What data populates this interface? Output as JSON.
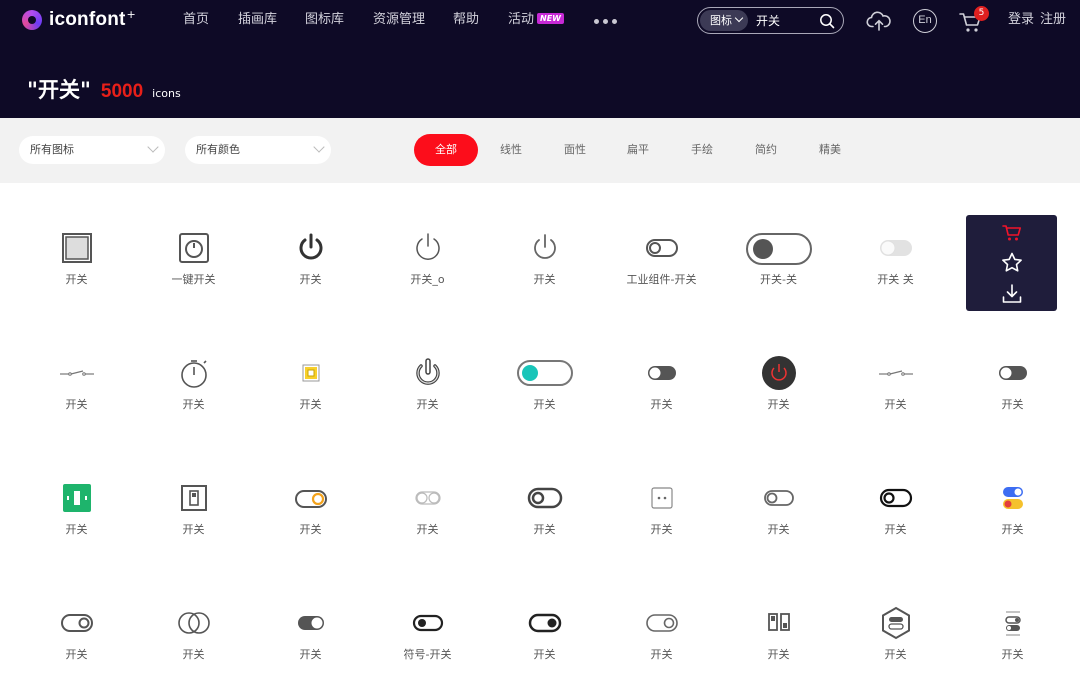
{
  "header": {
    "logo_text": "iconfont",
    "logo_plus": "+",
    "nav": [
      "首页",
      "插画库",
      "图标库",
      "资源管理",
      "帮助",
      "活动"
    ],
    "nav_badge": "NEW",
    "search": {
      "type": "图标",
      "query": "开关"
    },
    "cart_count": "5",
    "lang_label": "En",
    "login": "登录",
    "register": "注册"
  },
  "heading": {
    "query": "\"开关\"",
    "count": "5000",
    "unit": "icons"
  },
  "filters": {
    "icon_scope": "所有图标",
    "color_scope": "所有颜色",
    "style_tabs": [
      "全部",
      "线性",
      "面性",
      "扁平",
      "手绘",
      "简约",
      "精美"
    ],
    "active_tab": "全部"
  },
  "icons": [
    {
      "label": "开关",
      "icon": "square-frame-icon"
    },
    {
      "label": "一键开关",
      "icon": "washer-button-icon"
    },
    {
      "label": "开关",
      "icon": "power-icon-bold"
    },
    {
      "label": "开关_o",
      "icon": "power-icon-thin"
    },
    {
      "label": "开关",
      "icon": "power-icon-gray"
    },
    {
      "label": "工业组件-开关",
      "icon": "toggle-outline-icon"
    },
    {
      "label": "开关-关",
      "icon": "toggle-large-off-icon"
    },
    {
      "label": "开关 关",
      "icon": "toggle-light-icon"
    },
    {
      "label": "",
      "icon": "hidden-icon"
    },
    {
      "label": "开关",
      "icon": "circuit-switch-icon"
    },
    {
      "label": "开关",
      "icon": "timer-icon"
    },
    {
      "label": "开关",
      "icon": "yellow-wall-switch-icon"
    },
    {
      "label": "开关",
      "icon": "power-3d-icon"
    },
    {
      "label": "开关",
      "icon": "toggle-teal-icon"
    },
    {
      "label": "开关",
      "icon": "toggle-dark-small-icon"
    },
    {
      "label": "开关",
      "icon": "power-red-circle-icon"
    },
    {
      "label": "开关",
      "icon": "circuit-switch-icon"
    },
    {
      "label": "开关",
      "icon": "toggle-dark-small-icon"
    },
    {
      "label": "开关",
      "icon": "green-switch-icon"
    },
    {
      "label": "开关",
      "icon": "wall-switch-icon"
    },
    {
      "label": "开关",
      "icon": "toggle-orange-icon"
    },
    {
      "label": "开关",
      "icon": "toggle-faint-icon"
    },
    {
      "label": "开关",
      "icon": "toggle-bold-icon"
    },
    {
      "label": "开关",
      "icon": "socket-icon"
    },
    {
      "label": "开关",
      "icon": "toggle-gray-icon"
    },
    {
      "label": "开关",
      "icon": "toggle-black-icon"
    },
    {
      "label": "开关",
      "icon": "colored-toggles-icon"
    },
    {
      "label": "开关",
      "icon": "toggle-knob-right-icon"
    },
    {
      "label": "开关",
      "icon": "double-circle-icon"
    },
    {
      "label": "开关",
      "icon": "toggle-half-fill-icon"
    },
    {
      "label": "符号-开关",
      "icon": "toggle-filled-left-icon"
    },
    {
      "label": "开关",
      "icon": "toggle-filled-right-icon"
    },
    {
      "label": "开关",
      "icon": "toggle-outline-right-icon"
    },
    {
      "label": "开关",
      "icon": "double-rect-icon"
    },
    {
      "label": "开关",
      "icon": "hexagon-toggle-icon"
    },
    {
      "label": "开关",
      "icon": "settings-toggles-icon"
    }
  ],
  "colors": {
    "accent": "#fc0d1b",
    "header_bg": "#0e0a26",
    "count_red": "#e71f19",
    "panel_bg": "#1f1d3b"
  }
}
